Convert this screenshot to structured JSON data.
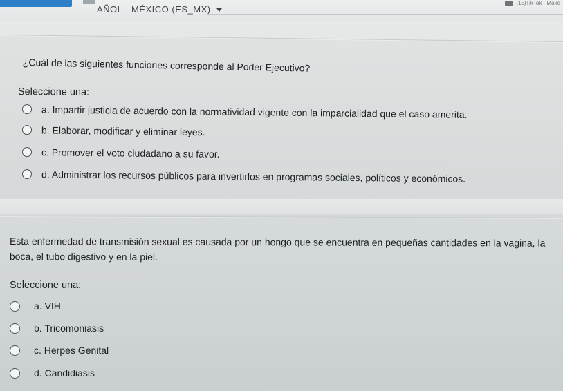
{
  "header": {
    "language_label": "AÑOL - MÉXICO (ES_MX)",
    "tab_hint": "(15)TikTok - Make"
  },
  "question1": {
    "prompt": "¿Cuál de las siguientes funciones corresponde al Poder Ejecutivo?",
    "select_label": "Seleccione una:",
    "options": [
      {
        "label": "a. Impartir justicia de acuerdo con la normatividad vigente con la imparcialidad que el caso amerita."
      },
      {
        "label": "b. Elaborar, modificar y eliminar leyes."
      },
      {
        "label": "c. Promover el voto ciudadano a su favor."
      },
      {
        "label": "d. Administrar los recursos públicos para invertirlos en programas sociales, políticos y económicos."
      }
    ]
  },
  "question2": {
    "prompt": "Esta enfermedad de transmisión sexual es causada por un hongo que se encuentra en pequeñas cantidades en la vagina, la boca, el tubo digestivo y en la piel.",
    "select_label": "Seleccione una:",
    "options": [
      {
        "label": "a. VIH"
      },
      {
        "label": "b. Tricomoniasis"
      },
      {
        "label": "c. Herpes Genital"
      },
      {
        "label": "d. Candidiasis"
      }
    ]
  },
  "colors": {
    "brand": "#2d7fc8",
    "text": "#1d2123",
    "background": "#dcdfde"
  }
}
